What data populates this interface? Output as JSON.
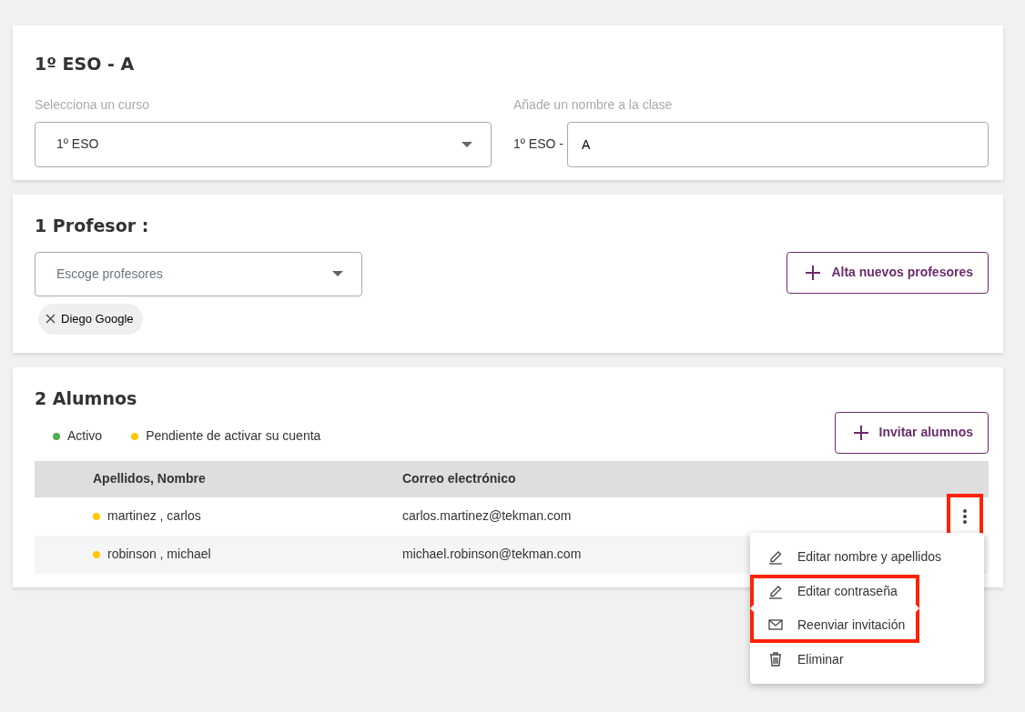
{
  "class_card": {
    "title": "1º ESO - A",
    "course": {
      "label": "Selecciona un curso",
      "value": "1º ESO"
    },
    "name": {
      "label": "Añade un nombre a la clase",
      "prefix": "1º ESO -",
      "value": "A"
    }
  },
  "teachers_card": {
    "title": "1 Profesor :",
    "select": {
      "placeholder": "Escoge profesores"
    },
    "add_button": "Alta nuevos profesores",
    "chips": [
      {
        "label": "Diego Google"
      }
    ]
  },
  "students_card": {
    "title": "2 Alumnos",
    "legend": [
      {
        "label": "Activo",
        "color": "#4caf50"
      },
      {
        "label": "Pendiente de activar su cuenta",
        "color": "#ffc800"
      }
    ],
    "invite_button": "Invitar alumnos",
    "table": {
      "columns": [
        "Apellidos, Nombre",
        "Correo electrónico"
      ],
      "rows": [
        {
          "name": "martinez , carlos",
          "email": "carlos.martinez@tekman.com",
          "color": "#ffc800",
          "menu_open": true,
          "highlighted": true
        },
        {
          "name": "robinson , michael",
          "email": "michael.robinson@tekman.com",
          "color": "#ffc800",
          "menu_open": false,
          "highlighted": false
        }
      ]
    },
    "menu": {
      "items": [
        {
          "kind": "edit",
          "label": "Editar nombre y apellidos",
          "highlighted": false
        },
        {
          "kind": "edit",
          "label": "Editar contraseña",
          "highlighted": true
        },
        {
          "kind": "mail",
          "label": "Reenviar invitación",
          "highlighted": true
        },
        {
          "kind": "delete",
          "label": "Eliminar",
          "highlighted": false
        }
      ]
    }
  }
}
